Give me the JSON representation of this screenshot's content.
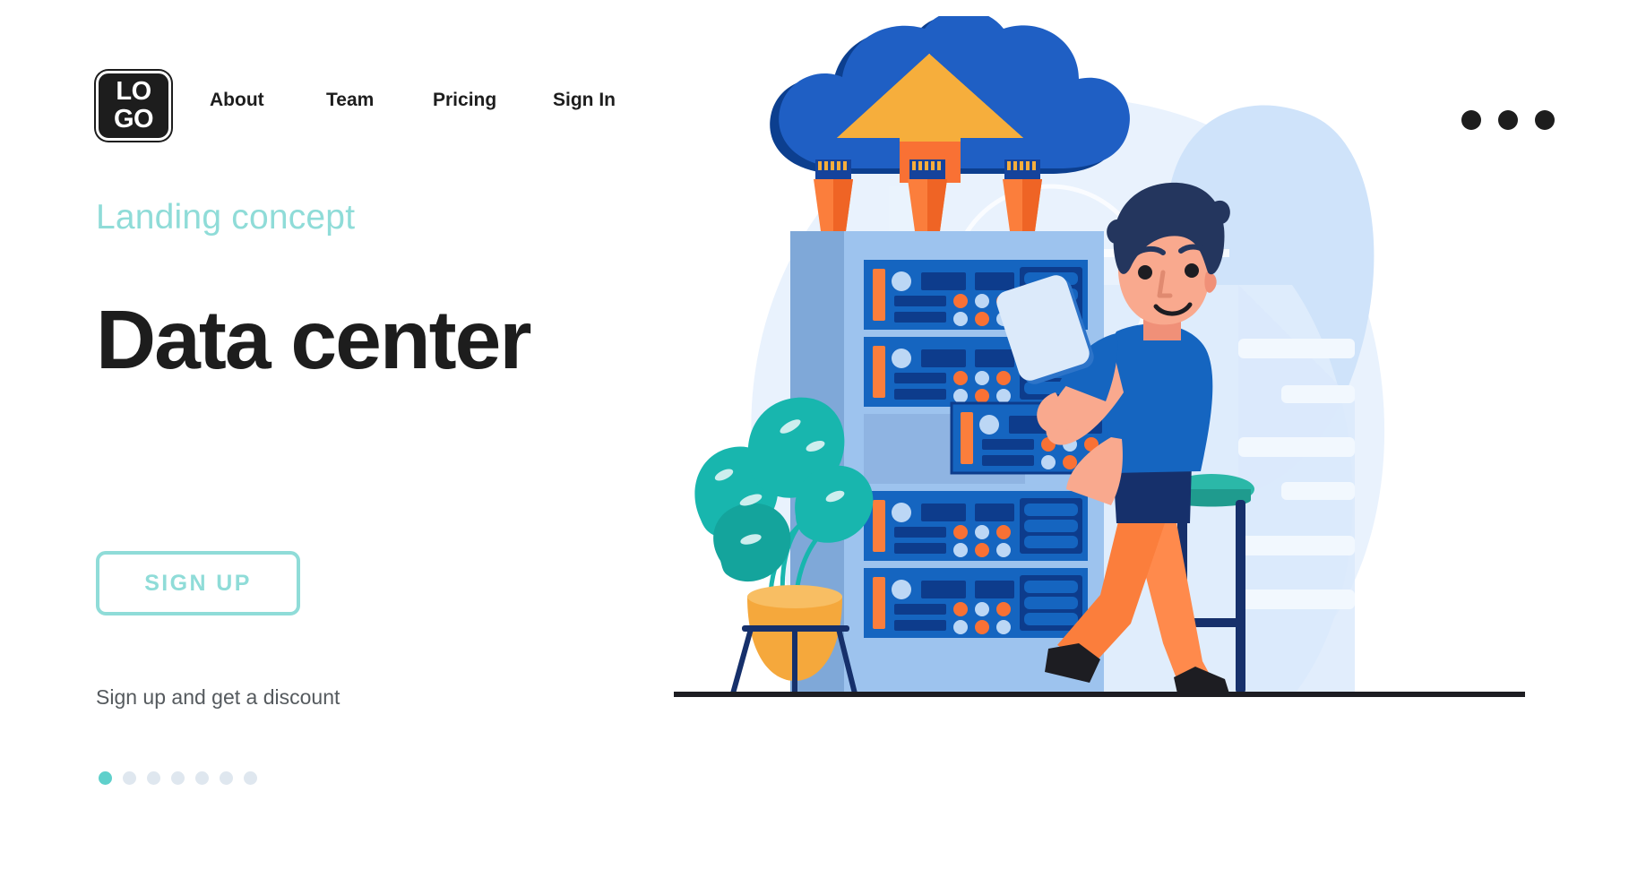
{
  "nav": {
    "logo": {
      "line1": "LO",
      "line2": "GO",
      "name": "logo"
    },
    "links": [
      {
        "label": "About"
      },
      {
        "label": "Team"
      },
      {
        "label": "Pricing"
      },
      {
        "label": "Sign In"
      }
    ],
    "menu_icon": "kebab-menu-icon"
  },
  "hero": {
    "eyebrow": "Landing concept",
    "headline": "Data center",
    "cta_label": "SIGN UP",
    "subtext": "Sign up and get a discount",
    "pagination": {
      "total": 7,
      "active_index": 0
    }
  },
  "illustration": {
    "name": "data-center-illustration",
    "alt": "Man on a stool with a tablet servicing a server rack connected to a cloud",
    "elements": [
      "cloud-upload-icon",
      "ethernet-plug",
      "server-rack",
      "server-unit",
      "technician-character",
      "tablet-device",
      "bar-stool",
      "monstera-plant",
      "floor-line"
    ]
  },
  "colors": {
    "accent_teal": "#8fdcd8",
    "dot_active": "#5fd0cb",
    "headline": "#1d1d1d",
    "subtext": "#555a5e",
    "brand_blue": "#1565c0",
    "deep_blue": "#0d3c8c",
    "navy": "#16306b",
    "orange": "#f97134",
    "orange_light": "#ff8a4c",
    "yellow": "#f6ae3c",
    "skin": "#f9a98e",
    "bg_blue_light": "#d6e6fb",
    "bg_blue_pale": "#eaf3fd",
    "plant_teal": "#18b6ae",
    "rack_blue": "#9dc3ee",
    "rack_side": "#7fa8d8"
  }
}
